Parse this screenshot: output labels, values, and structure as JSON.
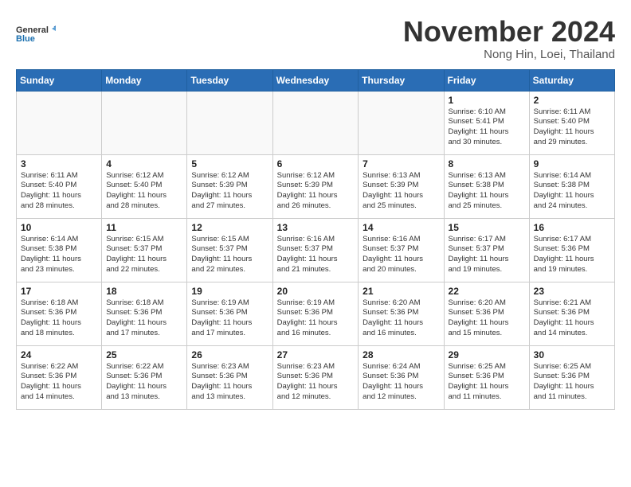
{
  "logo": {
    "line1": "General",
    "line2": "Blue"
  },
  "title": "November 2024",
  "location": "Nong Hin, Loei, Thailand",
  "days_header": [
    "Sunday",
    "Monday",
    "Tuesday",
    "Wednesday",
    "Thursday",
    "Friday",
    "Saturday"
  ],
  "weeks": [
    [
      {
        "day": "",
        "info": ""
      },
      {
        "day": "",
        "info": ""
      },
      {
        "day": "",
        "info": ""
      },
      {
        "day": "",
        "info": ""
      },
      {
        "day": "",
        "info": ""
      },
      {
        "day": "1",
        "info": "Sunrise: 6:10 AM\nSunset: 5:41 PM\nDaylight: 11 hours\nand 30 minutes."
      },
      {
        "day": "2",
        "info": "Sunrise: 6:11 AM\nSunset: 5:40 PM\nDaylight: 11 hours\nand 29 minutes."
      }
    ],
    [
      {
        "day": "3",
        "info": "Sunrise: 6:11 AM\nSunset: 5:40 PM\nDaylight: 11 hours\nand 28 minutes."
      },
      {
        "day": "4",
        "info": "Sunrise: 6:12 AM\nSunset: 5:40 PM\nDaylight: 11 hours\nand 28 minutes."
      },
      {
        "day": "5",
        "info": "Sunrise: 6:12 AM\nSunset: 5:39 PM\nDaylight: 11 hours\nand 27 minutes."
      },
      {
        "day": "6",
        "info": "Sunrise: 6:12 AM\nSunset: 5:39 PM\nDaylight: 11 hours\nand 26 minutes."
      },
      {
        "day": "7",
        "info": "Sunrise: 6:13 AM\nSunset: 5:39 PM\nDaylight: 11 hours\nand 25 minutes."
      },
      {
        "day": "8",
        "info": "Sunrise: 6:13 AM\nSunset: 5:38 PM\nDaylight: 11 hours\nand 25 minutes."
      },
      {
        "day": "9",
        "info": "Sunrise: 6:14 AM\nSunset: 5:38 PM\nDaylight: 11 hours\nand 24 minutes."
      }
    ],
    [
      {
        "day": "10",
        "info": "Sunrise: 6:14 AM\nSunset: 5:38 PM\nDaylight: 11 hours\nand 23 minutes."
      },
      {
        "day": "11",
        "info": "Sunrise: 6:15 AM\nSunset: 5:37 PM\nDaylight: 11 hours\nand 22 minutes."
      },
      {
        "day": "12",
        "info": "Sunrise: 6:15 AM\nSunset: 5:37 PM\nDaylight: 11 hours\nand 22 minutes."
      },
      {
        "day": "13",
        "info": "Sunrise: 6:16 AM\nSunset: 5:37 PM\nDaylight: 11 hours\nand 21 minutes."
      },
      {
        "day": "14",
        "info": "Sunrise: 6:16 AM\nSunset: 5:37 PM\nDaylight: 11 hours\nand 20 minutes."
      },
      {
        "day": "15",
        "info": "Sunrise: 6:17 AM\nSunset: 5:37 PM\nDaylight: 11 hours\nand 19 minutes."
      },
      {
        "day": "16",
        "info": "Sunrise: 6:17 AM\nSunset: 5:36 PM\nDaylight: 11 hours\nand 19 minutes."
      }
    ],
    [
      {
        "day": "17",
        "info": "Sunrise: 6:18 AM\nSunset: 5:36 PM\nDaylight: 11 hours\nand 18 minutes."
      },
      {
        "day": "18",
        "info": "Sunrise: 6:18 AM\nSunset: 5:36 PM\nDaylight: 11 hours\nand 17 minutes."
      },
      {
        "day": "19",
        "info": "Sunrise: 6:19 AM\nSunset: 5:36 PM\nDaylight: 11 hours\nand 17 minutes."
      },
      {
        "day": "20",
        "info": "Sunrise: 6:19 AM\nSunset: 5:36 PM\nDaylight: 11 hours\nand 16 minutes."
      },
      {
        "day": "21",
        "info": "Sunrise: 6:20 AM\nSunset: 5:36 PM\nDaylight: 11 hours\nand 16 minutes."
      },
      {
        "day": "22",
        "info": "Sunrise: 6:20 AM\nSunset: 5:36 PM\nDaylight: 11 hours\nand 15 minutes."
      },
      {
        "day": "23",
        "info": "Sunrise: 6:21 AM\nSunset: 5:36 PM\nDaylight: 11 hours\nand 14 minutes."
      }
    ],
    [
      {
        "day": "24",
        "info": "Sunrise: 6:22 AM\nSunset: 5:36 PM\nDaylight: 11 hours\nand 14 minutes."
      },
      {
        "day": "25",
        "info": "Sunrise: 6:22 AM\nSunset: 5:36 PM\nDaylight: 11 hours\nand 13 minutes."
      },
      {
        "day": "26",
        "info": "Sunrise: 6:23 AM\nSunset: 5:36 PM\nDaylight: 11 hours\nand 13 minutes."
      },
      {
        "day": "27",
        "info": "Sunrise: 6:23 AM\nSunset: 5:36 PM\nDaylight: 11 hours\nand 12 minutes."
      },
      {
        "day": "28",
        "info": "Sunrise: 6:24 AM\nSunset: 5:36 PM\nDaylight: 11 hours\nand 12 minutes."
      },
      {
        "day": "29",
        "info": "Sunrise: 6:25 AM\nSunset: 5:36 PM\nDaylight: 11 hours\nand 11 minutes."
      },
      {
        "day": "30",
        "info": "Sunrise: 6:25 AM\nSunset: 5:36 PM\nDaylight: 11 hours\nand 11 minutes."
      }
    ]
  ]
}
